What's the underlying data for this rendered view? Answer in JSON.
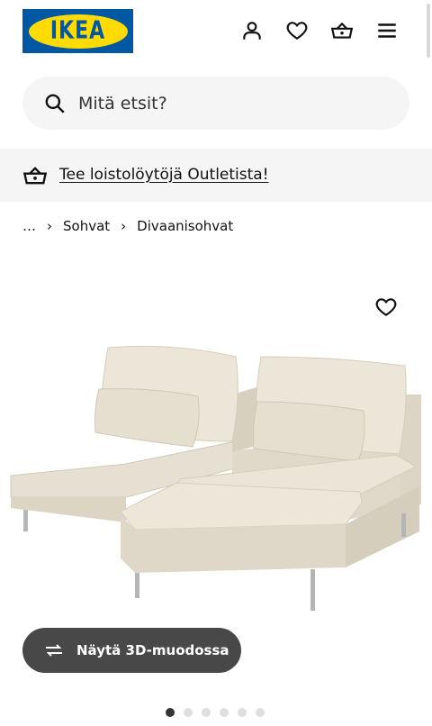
{
  "header": {
    "logo_text": "IKEA",
    "icons": [
      "account-icon",
      "heart-icon",
      "basket-icon",
      "menu-icon"
    ]
  },
  "search": {
    "placeholder": "Mitä etsit?",
    "value": ""
  },
  "banner": {
    "icon": "basket-icon",
    "link_text": "Tee loistolöytöjä Outletista!"
  },
  "breadcrumb": {
    "items": [
      "…",
      "Sohvat",
      "Divaanisohvat"
    ]
  },
  "product": {
    "favourite_icon": "heart-icon",
    "view3d_icon": "rotate-3d-icon",
    "view3d_label": "Näytä 3D-muodossa"
  },
  "gallery": {
    "image_count": 6,
    "active_index": 0
  },
  "colors": {
    "brand_blue": "#0058a3",
    "brand_yellow": "#ffdb00",
    "surface_gray": "#f5f5f5",
    "button_dark": "#484848",
    "sofa_fabric": "#e3dccd"
  }
}
